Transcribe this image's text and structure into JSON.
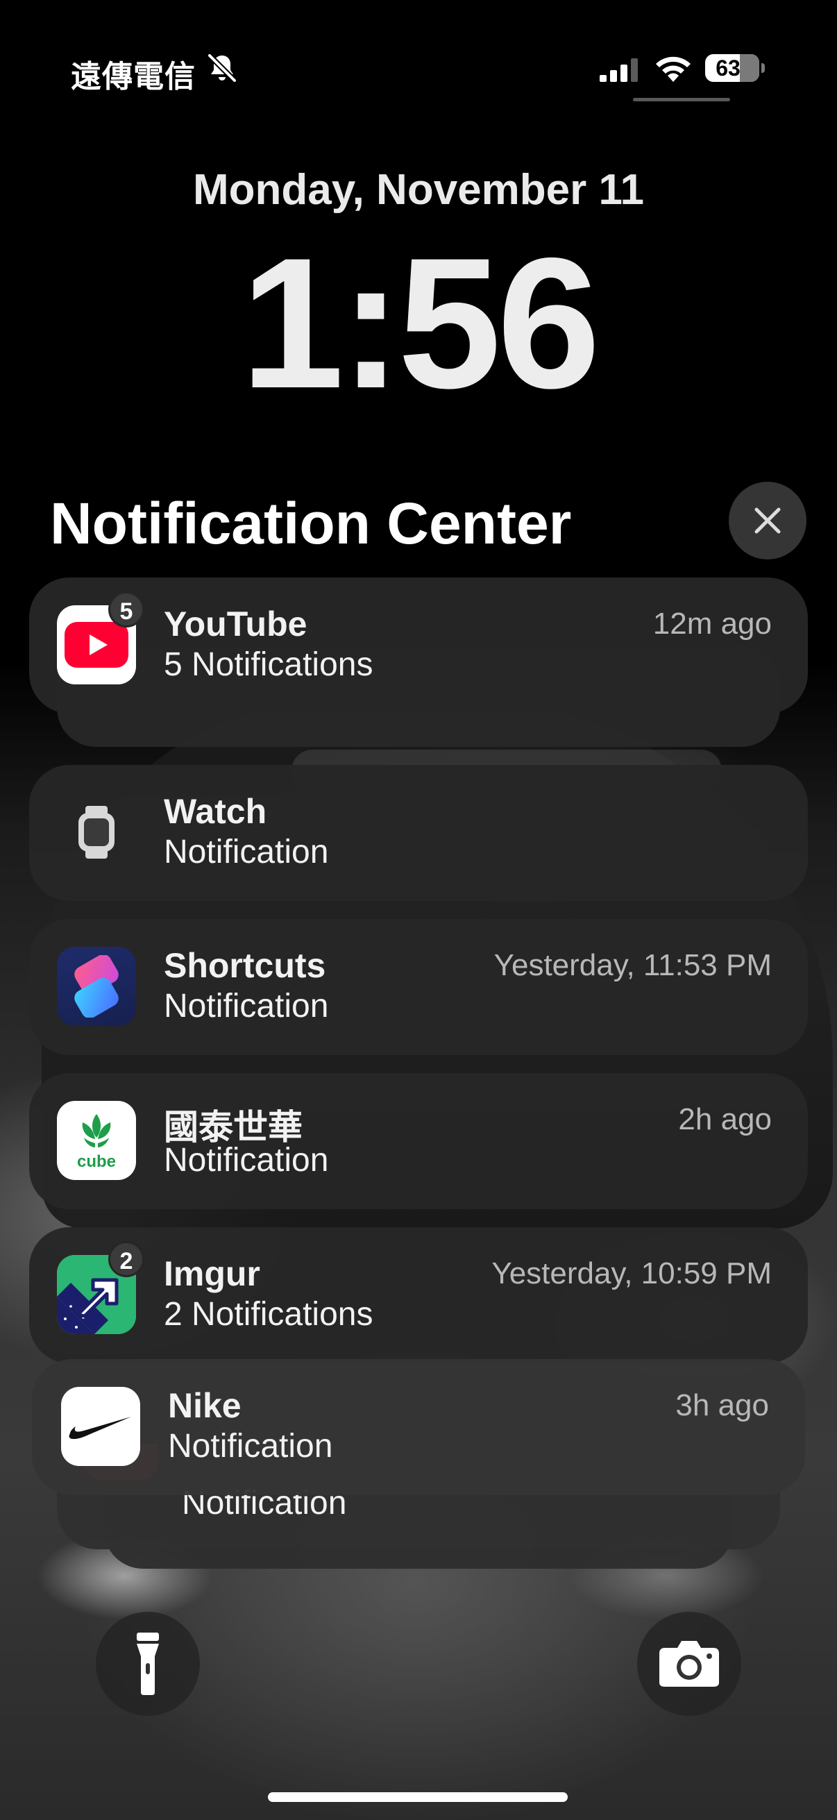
{
  "status_bar": {
    "carrier": "遠傳電信",
    "battery_percent": "63",
    "icons": [
      "bell-slash-icon",
      "cellular-signal-icon",
      "wifi-icon",
      "battery-icon"
    ]
  },
  "lock": {
    "date": "Monday, November 11",
    "time": "1:56"
  },
  "notification_center": {
    "title": "Notification Center",
    "close_icon": "close-icon"
  },
  "notifications": [
    {
      "app": "YouTube",
      "body": "5 Notifications",
      "time": "12m ago",
      "badge": "5",
      "icon": "youtube-icon",
      "color": "#ff0033"
    },
    {
      "app": "Watch",
      "body": "Notification",
      "time": "",
      "icon": "watch-icon"
    },
    {
      "app": "Shortcuts",
      "body": "Notification",
      "time": "Yesterday, 11:53 PM",
      "icon": "shortcuts-icon"
    },
    {
      "app": "國泰世華",
      "body": "Notification",
      "time": "2h ago",
      "icon": "cathay-cube-icon",
      "icon_text": "cube",
      "color": "#1e9e4a"
    },
    {
      "app": "Imgur",
      "body": "2 Notifications",
      "time": "Yesterday, 10:59 PM",
      "badge": "2",
      "icon": "imgur-icon"
    },
    {
      "app": "Nike",
      "body": "Notification",
      "time": "3h ago",
      "icon": "nike-swoosh-icon"
    },
    {
      "app": "",
      "body": "Notification",
      "time": "",
      "icon": "app-icon-partial",
      "color": "#e8505b"
    }
  ],
  "bottom": {
    "flashlight_icon": "flashlight-icon",
    "camera_icon": "camera-icon"
  }
}
